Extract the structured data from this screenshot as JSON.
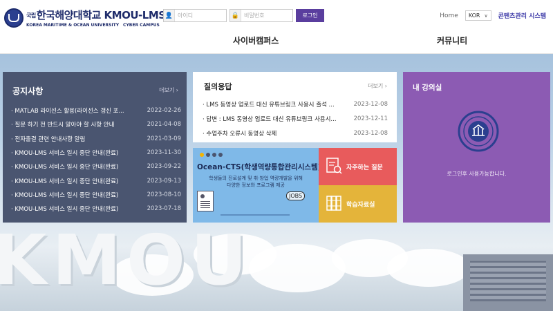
{
  "header": {
    "logo": {
      "mark": "국립",
      "title": "한국해양대학교 KMOU-LMS",
      "subtitle": "KOREA MARITIME & OCEAN UNIVERSITY",
      "tag": "CYBER CAMPUS"
    },
    "login": {
      "id_placeholder": "아이디",
      "pw_placeholder": "비밀번호",
      "button": "로그인"
    },
    "home": "Home",
    "language": "KOR",
    "content_system": "콘텐츠관리 시스템",
    "nav": [
      "사이버캠퍼스",
      "커뮤니티"
    ]
  },
  "notice": {
    "title": "공지사항",
    "more": "더보기",
    "items": [
      {
        "title": "MATLAB 라이선스 활용(라이선스 갱신 포...",
        "date": "2022-02-26"
      },
      {
        "title": "질문 하기 전 반드시 알아야 할 사항 안내",
        "date": "2021-04-08"
      },
      {
        "title": "전자출결 관련 안내사항 알림",
        "date": "2021-03-09"
      },
      {
        "title": "KMOU-LMS 서비스 일시 중단 안내(완료)",
        "date": "2023-11-30"
      },
      {
        "title": "KMOU-LMS 서비스 일시 중단 안내(완료)",
        "date": "2023-09-22"
      },
      {
        "title": "KMOU-LMS 서비스 일시 중단 안내(완료)",
        "date": "2023-09-13"
      },
      {
        "title": "KMOU-LMS 서비스 일시 중단 안내(완료)",
        "date": "2023-08-10"
      },
      {
        "title": "KMOU-LMS 서비스 일시 중단 안내(완료)",
        "date": "2023-07-18"
      }
    ]
  },
  "qna": {
    "title": "질의응답",
    "more": "더보기",
    "items": [
      {
        "title": "LMS 동영상 업로드 대신 유튜브링크 사용시 출석 ...",
        "date": "2023-12-08"
      },
      {
        "title": "답변 : LMS 동영상 업로드 대신 유튜브링크 사용시...",
        "date": "2023-12-11"
      },
      {
        "title": "수업주차 오류시 동영상 삭제",
        "date": "2023-12-08"
      }
    ]
  },
  "cts": {
    "title": "Ocean-CTS(학생역량통합관리시스템)",
    "desc_line1": "학생들의 진로설계 및 취·창업 역량개발을 위해",
    "desc_line2": "다양한 정보와 프로그램 제공",
    "badge": "JOBS"
  },
  "faq": {
    "label": "자주하는 질문"
  },
  "resources": {
    "label": "학습자료실"
  },
  "my_lecture": {
    "title": "내 강의실",
    "message": "로그인후 사용가능합니다."
  },
  "background": {
    "letters": "KMOU"
  },
  "colors": {
    "notice_bg": "#4a5570",
    "qna_bg": "#ffffff",
    "cts_bg": "#7fb9e8",
    "faq_bg": "#e85b5c",
    "resources_bg": "#e4b43a",
    "my_lecture_bg": "#8c5bb3",
    "login_button": "#5a3e9e"
  }
}
